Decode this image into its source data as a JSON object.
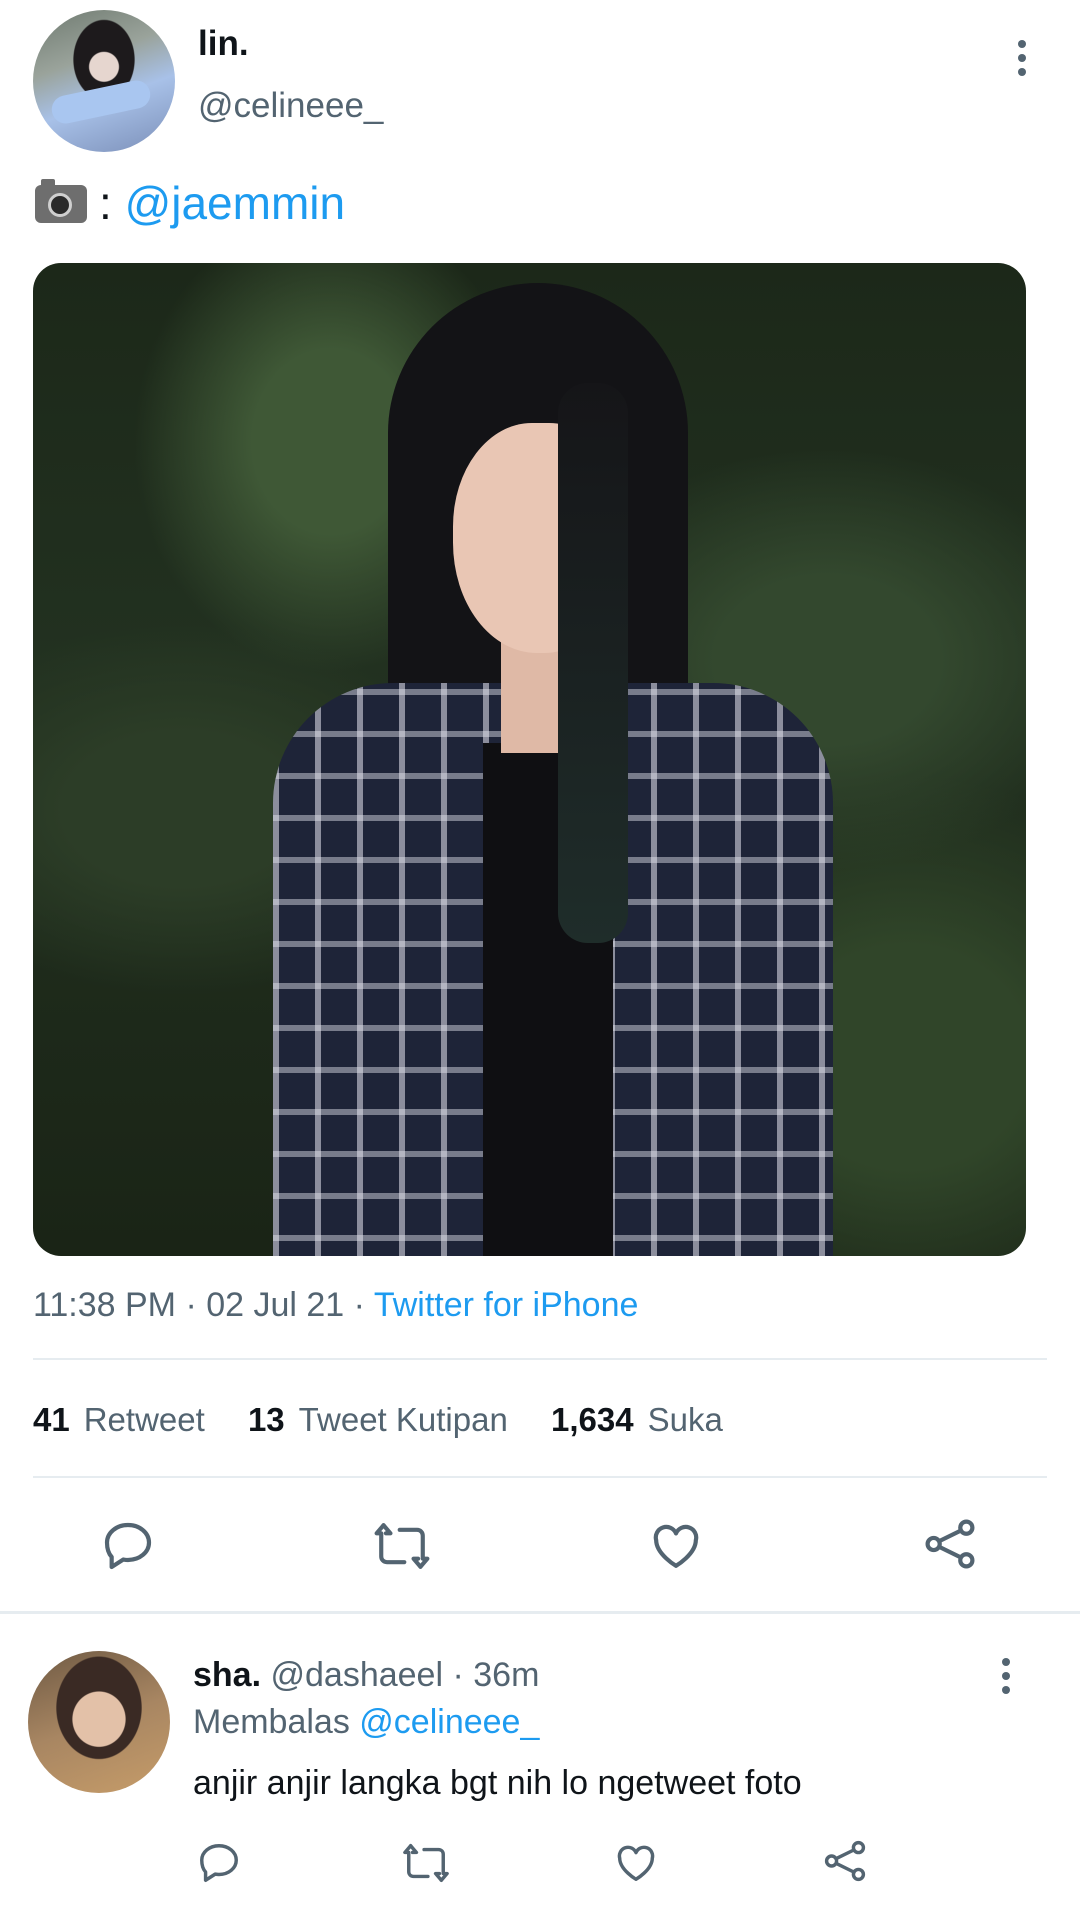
{
  "tweet": {
    "author_name": "lin.",
    "author_handle": "@celineee_",
    "text_mention": "@jaemmin",
    "text_separator": ":",
    "timestamp": "11:38 PM · 02 Jul 21 ·",
    "source": "Twitter for iPhone",
    "stats": {
      "retweets_count": "41",
      "retweets_label": "Retweet",
      "quotes_count": "13",
      "quotes_label": "Tweet Kutipan",
      "likes_count": "1,634",
      "likes_label": "Suka"
    }
  },
  "reply": {
    "author_name": "sha.",
    "author_handle": "@dashaeel",
    "time": "· 36m",
    "replying_label": "Membalas",
    "replying_to": "@celineee_",
    "text": "anjir anjir langka bgt nih lo ngetweet foto"
  },
  "colors": {
    "accent": "#1d9bf0",
    "secondary_text": "#536471",
    "icon": "#536471"
  },
  "icons": [
    "camera-icon",
    "more-options-icon",
    "reply-icon",
    "retweet-icon",
    "like-icon",
    "share-icon"
  ]
}
